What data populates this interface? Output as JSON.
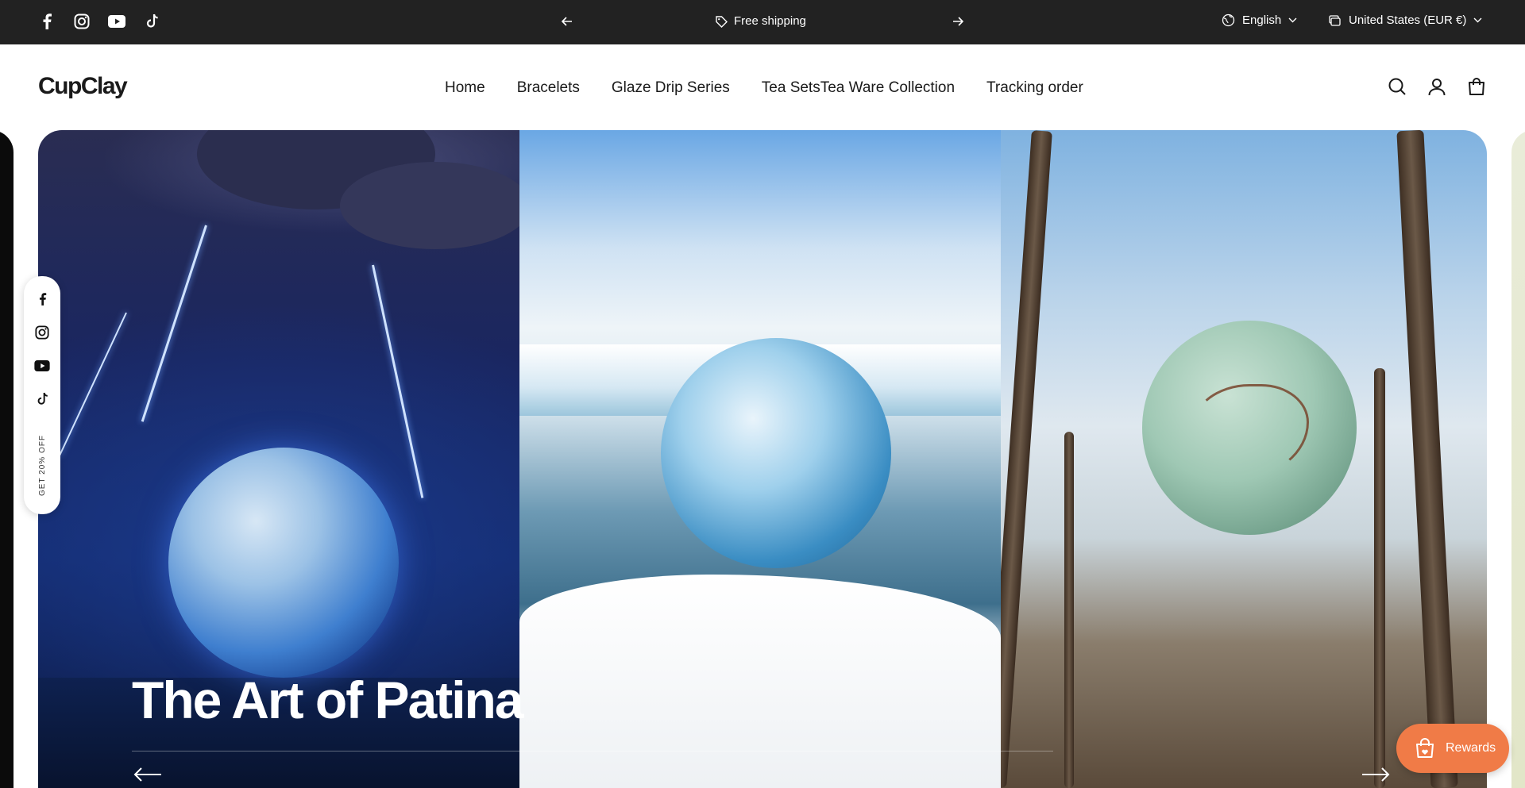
{
  "announcement": {
    "text": "Free shipping",
    "icon": "tag-icon",
    "prev_icon": "arrow-left-icon",
    "next_icon": "arrow-right-icon"
  },
  "topbar_socials": [
    "facebook-icon",
    "instagram-icon",
    "youtube-icon",
    "tiktok-icon"
  ],
  "localization": {
    "language": "English",
    "country": "United States (EUR €)"
  },
  "header": {
    "logo": "CupClay",
    "nav": [
      "Home",
      "Bracelets",
      "Glaze Drip Series",
      "Tea SetsTea Ware Collection",
      "Tracking order"
    ],
    "icons": [
      "search-icon",
      "account-icon",
      "cart-icon"
    ]
  },
  "hero": {
    "title": "The Art of Patina",
    "panels": [
      "storm",
      "glacier",
      "forest"
    ]
  },
  "floating_social": {
    "icons": [
      "facebook-icon",
      "instagram-icon",
      "youtube-icon",
      "tiktok-icon"
    ],
    "promo": "GET 20% OFF"
  },
  "rewards": {
    "label": "Rewards"
  },
  "colors": {
    "topbar_bg": "#222222",
    "rewards_bg": "#f07b47",
    "text": "#1a1a1a"
  }
}
